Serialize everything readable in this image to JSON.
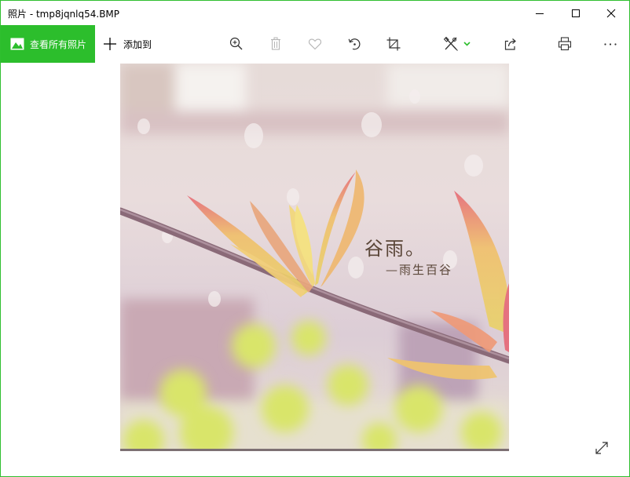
{
  "window": {
    "title": "照片 - tmp8jqnlq54.BMP",
    "accent_color": "#2cbe2c",
    "controls": {
      "minimize": "minimize-icon",
      "maximize": "maximize-icon",
      "close": "close-icon"
    }
  },
  "toolbar": {
    "view_all_label": "查看所有照片",
    "add_to_label": "添加到",
    "icons": [
      "zoom-in-icon",
      "delete-icon",
      "favorite-icon",
      "rotate-icon",
      "crop-icon",
      "edit-create-icon",
      "share-icon",
      "print-icon",
      "more-icon"
    ]
  },
  "photo": {
    "caption_main": "谷雨。",
    "caption_sub": "—雨生百谷"
  },
  "footer": {
    "fullscreen": "fullscreen-icon"
  }
}
